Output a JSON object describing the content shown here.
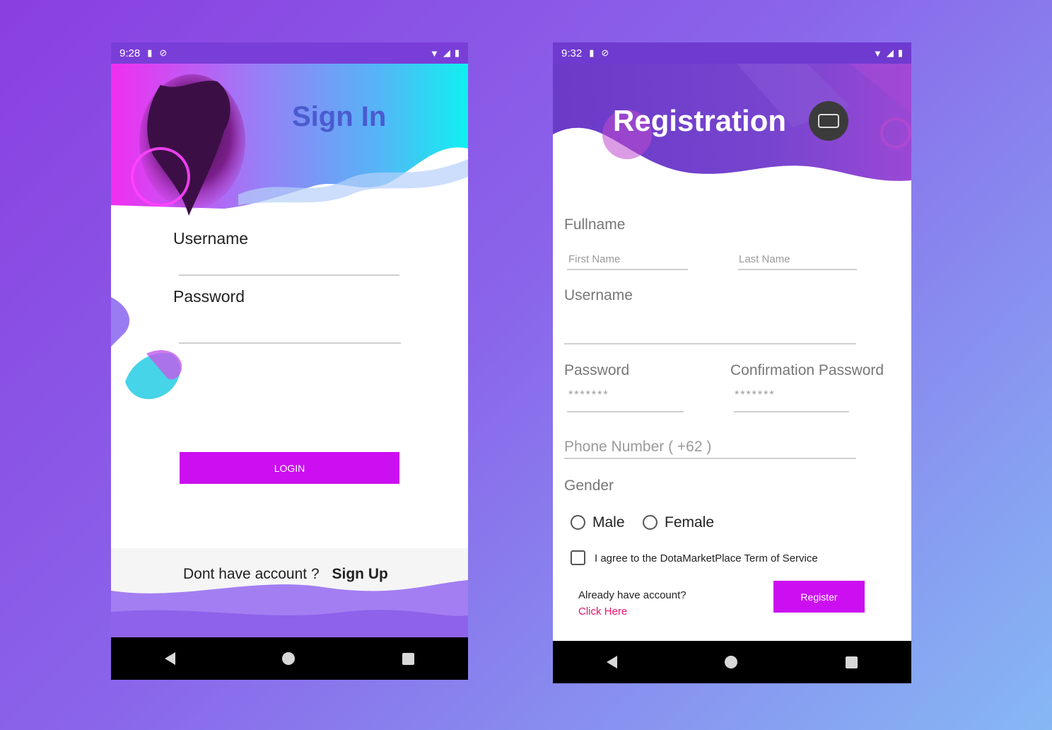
{
  "signin": {
    "status_time": "9:28",
    "title": "Sign In",
    "username_label": "Username",
    "password_label": "Password",
    "login_label": "LOGIN",
    "no_account_text": "Dont have account ?",
    "signup_label": "Sign Up"
  },
  "register": {
    "status_time": "9:32",
    "title": "Registration",
    "fullname_label": "Fullname",
    "first_name_placeholder": "First Name",
    "last_name_placeholder": "Last Name",
    "username_label": "Username",
    "password_label": "Password",
    "confirm_password_label": "Confirmation Password",
    "password_mask": "*******",
    "confirm_password_mask": "*******",
    "phone_placeholder": "Phone Number ( +62 )",
    "gender_label": "Gender",
    "male_label": "Male",
    "female_label": "Female",
    "terms_label": "I agree to the DotaMarketPlace Term of Service",
    "already_account_text": "Already have account?",
    "click_here_label": "Click Here",
    "register_label": "Register"
  },
  "colors": {
    "accent": "#cc0ff0",
    "title_blue": "#4a5bd0",
    "link_pink": "#e8126a",
    "header_purple": "#6a3ac8"
  },
  "icons": [
    "sd-card-icon",
    "sync-icon",
    "wifi-icon",
    "signal-icon",
    "battery-icon",
    "keyboard-icon",
    "back-icon",
    "home-icon",
    "recent-apps-icon"
  ]
}
